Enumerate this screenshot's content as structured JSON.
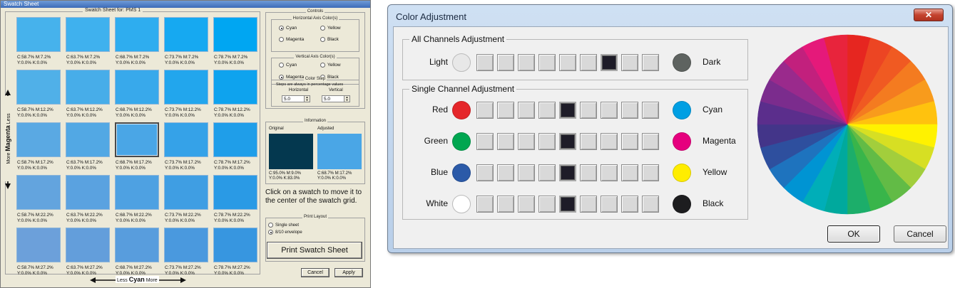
{
  "swatch_window": {
    "title": "Swatch Sheet",
    "grid_title": "Swatch Sheet for: PMS 1",
    "columns_cyan": [
      "C:58.7%",
      "C:63.7%",
      "C:68.7%",
      "C:73.7%",
      "C:78.7%"
    ],
    "rows_magenta": [
      "M:7.2%",
      "M:12.2%",
      "M:17.2%",
      "M:22.2%",
      "M:27.2%"
    ],
    "caption_line2": "Y:0.0% K:0.0%",
    "selected_swatch": {
      "row": 2,
      "col": 2
    },
    "row_colors": [
      [
        "#46b2ec",
        "#3fb1ee",
        "#2eadef",
        "#16a9f1",
        "#00a6f2"
      ],
      [
        "#50b0e8",
        "#47ade9",
        "#38a9eb",
        "#22a6ed",
        "#0ea3ee"
      ],
      [
        "#5aa9e3",
        "#52a8e4",
        "#4aa6e6",
        "#35a2e8",
        "#1f9ee9"
      ],
      [
        "#63a4de",
        "#5aa2e0",
        "#4ea1e2",
        "#3f9ee3",
        "#2a9ae5"
      ],
      [
        "#6ca0da",
        "#639edb",
        "#589ddd",
        "#4a99de",
        "#3796e0"
      ]
    ],
    "axis_vertical": {
      "less": "Less",
      "word": "Magenta",
      "more": "More"
    },
    "axis_horizontal": {
      "less": "Less",
      "word": "Cyan",
      "more": "More"
    },
    "controls": {
      "title": "Controls",
      "horizontal_group": "Horizontal Axis Color(s)",
      "vertical_group": "Vertical Axis Color(s)",
      "options": {
        "cyan": "Cyan",
        "yellow": "Yellow",
        "magenta": "Magenta",
        "black": "Black"
      },
      "color_step": "Color Step",
      "step_note": "Steps are always in percentage values",
      "horizontal_label": "Horizontal",
      "vertical_label": "Vertical",
      "horizontal_value": "5.0",
      "vertical_value": "5.0"
    },
    "information": {
      "title": "Information",
      "original_label": "Original",
      "adjusted_label": "Adjusted",
      "original_color": "#04384f",
      "adjusted_color": "#4aa6e6",
      "original_values": "C:95.0% M:9.0%\nY:0.0% K:83.0%",
      "adjusted_values": "C:68.7% M:17.2%\nY:0.0% K:0.0%"
    },
    "hint": "Click on a swatch to move it to the center of the swatch grid.",
    "print_layout": {
      "title": "Print Layout",
      "single": "Single sheet",
      "envelope": "8/10 envelope"
    },
    "print_button": "Print Swatch Sheet",
    "cancel_button": "Cancel",
    "apply_button": "Apply"
  },
  "adjust_dialog": {
    "title": "Color Adjustment",
    "close_glyph": "✕",
    "all_channels": {
      "title": "All Channels Adjustment",
      "left_label": "Light",
      "right_label": "Dark",
      "left_color": "#e8e8e8",
      "right_color": "#5e6360",
      "selected_index": 6
    },
    "single_channel": {
      "title": "Single Channel Adjustment",
      "rows": [
        {
          "left": "Red",
          "right": "Cyan",
          "left_color": "#e5262a",
          "right_color": "#009fe3",
          "selected_index": 4
        },
        {
          "left": "Green",
          "right": "Magenta",
          "left_color": "#00a650",
          "right_color": "#e6007e",
          "selected_index": 4
        },
        {
          "left": "Blue",
          "right": "Yellow",
          "left_color": "#2b5aa8",
          "right_color": "#ffed00",
          "selected_index": 4
        },
        {
          "left": "White",
          "right": "Black",
          "left_color": "#ffffff",
          "right_color": "#1d1d1f",
          "selected_index": 4
        }
      ]
    },
    "wheel_colors": [
      "#e62620",
      "#ec4523",
      "#f05a22",
      "#f47b20",
      "#f89b1c",
      "#ffc20e",
      "#fff200",
      "#d7df23",
      "#a2ce3c",
      "#62bb46",
      "#39b54a",
      "#1cae6a",
      "#00a99d",
      "#00aeb8",
      "#0094d3",
      "#1e73be",
      "#2e4f9e",
      "#433589",
      "#5b2e8c",
      "#7b2c8d",
      "#9a2a8c",
      "#c2207d",
      "#e5197a",
      "#e8243c"
    ],
    "ok_button": "OK",
    "cancel_button": "Cancel"
  }
}
